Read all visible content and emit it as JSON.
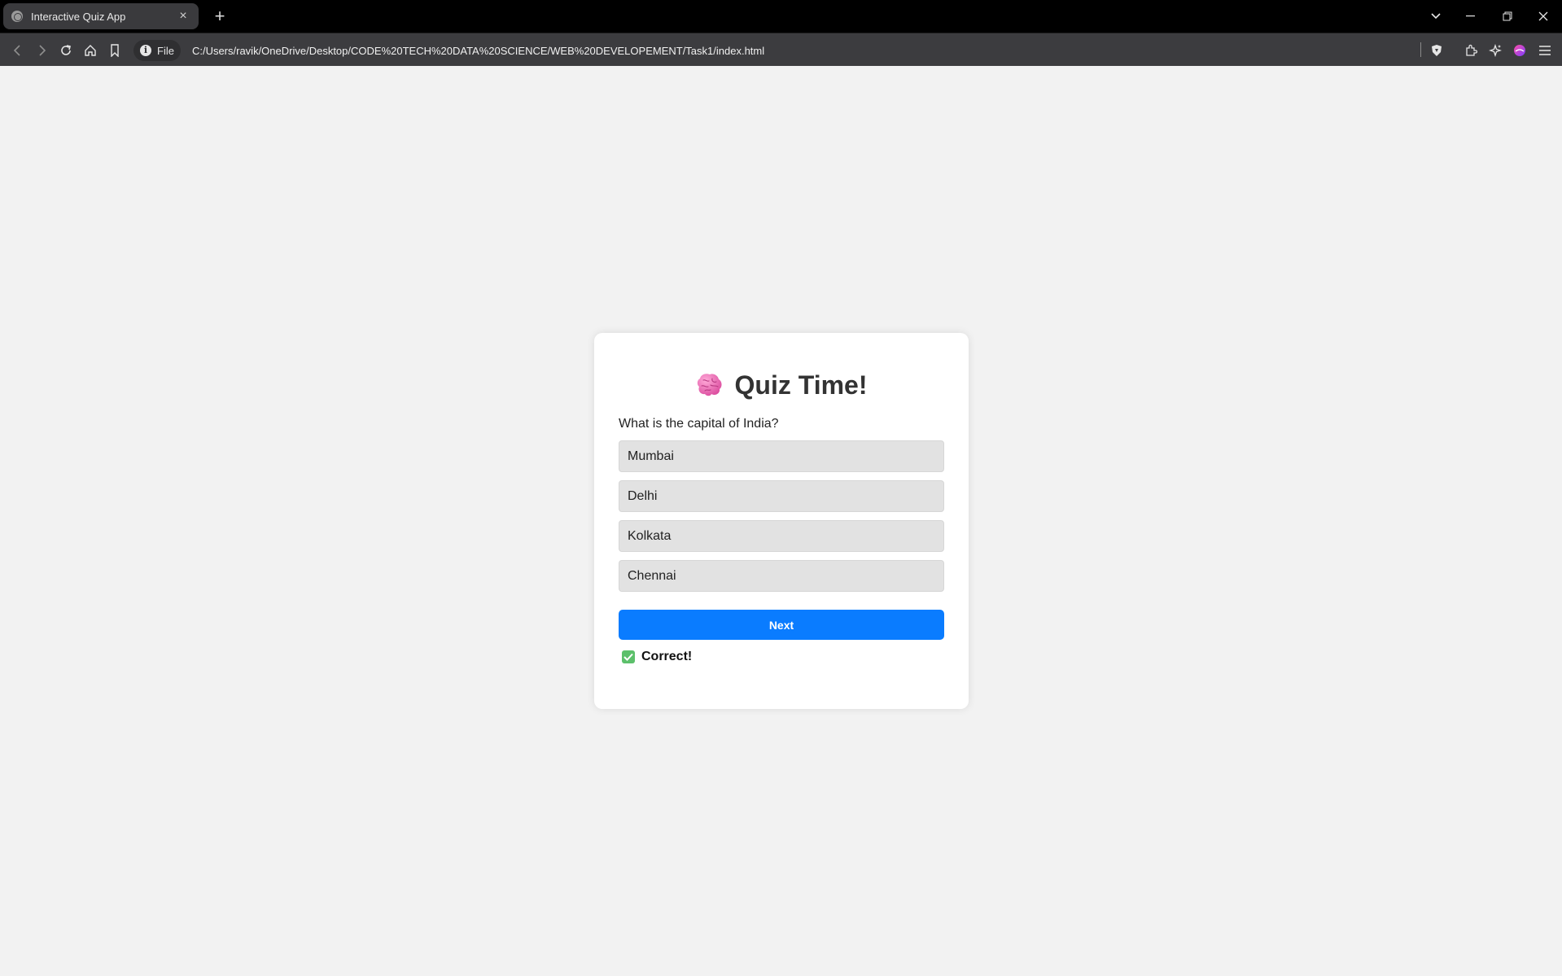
{
  "browser": {
    "tab_title": "Interactive Quiz App",
    "tab_close": "×",
    "new_tab": "+",
    "site_info_label": "File",
    "site_info_glyph": "i",
    "url": "C:/Users/ravik/OneDrive/Desktop/CODE%20TECH%20DATA%20SCIENCE/WEB%20DEVELOPEMENT/Task1/index.html"
  },
  "quiz": {
    "title": "Quiz Time!",
    "title_icon": "brain-icon",
    "question": "What is the capital of India?",
    "options": [
      "Mumbai",
      "Delhi",
      "Kolkata",
      "Chennai"
    ],
    "next_label": "Next",
    "feedback": "Correct!",
    "feedback_icon": "check-mark-icon"
  },
  "colors": {
    "page_bg": "#f2f2f2",
    "card_bg": "#ffffff",
    "option_bg": "#e2e2e2",
    "next_button": "#0a7cff",
    "feedback_check": "#5cc06b",
    "brain": "#e86ab4"
  }
}
